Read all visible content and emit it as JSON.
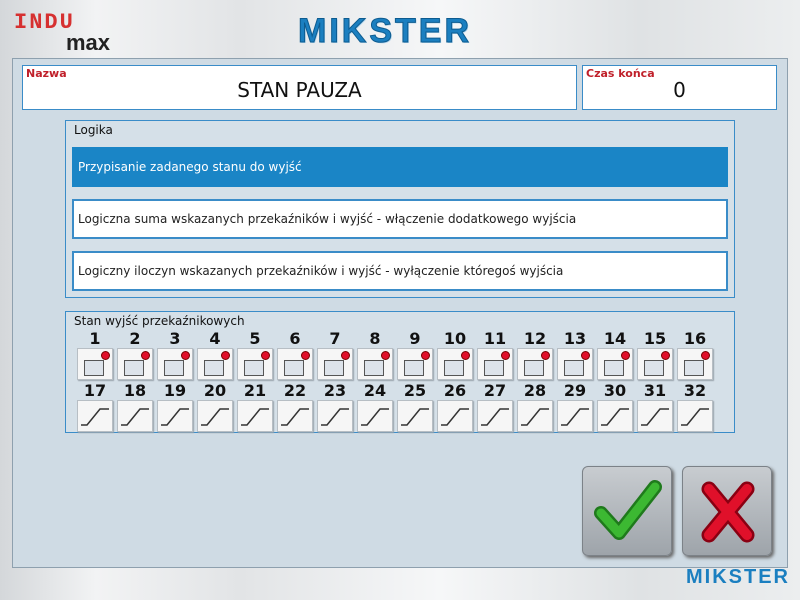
{
  "header": {
    "logo_top": "INDU",
    "logo_bottom": "max",
    "brand": "MIKSTER",
    "brand_footer": "MIKSTER"
  },
  "name_box": {
    "label": "Nazwa",
    "value": "STAN PAUZA"
  },
  "time_box": {
    "label": "Czas końca",
    "value": "0"
  },
  "logic": {
    "title": "Logika",
    "options": [
      {
        "label": "Przypisanie zadanego stanu do wyjść",
        "selected": true
      },
      {
        "label": "Logiczna suma wskazanych przekaźników i wyjść - włączenie dodatkowego wyjścia",
        "selected": false
      },
      {
        "label": "Logiczny iloczyn wskazanych przekaźników i wyjść - wyłączenie któregoś wyjścia",
        "selected": false
      }
    ]
  },
  "relays": {
    "title": "Stan wyjść przekaźnikowych",
    "row1": [
      "1",
      "2",
      "3",
      "4",
      "5",
      "6",
      "7",
      "8",
      "9",
      "10",
      "11",
      "12",
      "13",
      "14",
      "15",
      "16"
    ],
    "row2": [
      "17",
      "18",
      "19",
      "20",
      "21",
      "22",
      "23",
      "24",
      "25",
      "26",
      "27",
      "28",
      "29",
      "30",
      "31",
      "32"
    ]
  },
  "colors": {
    "accent": "#1a85c6",
    "ok": "#2e9e2a",
    "cancel": "#e0102a"
  },
  "actions": {
    "ok_icon": "checkmark-icon",
    "cancel_icon": "cross-icon"
  }
}
